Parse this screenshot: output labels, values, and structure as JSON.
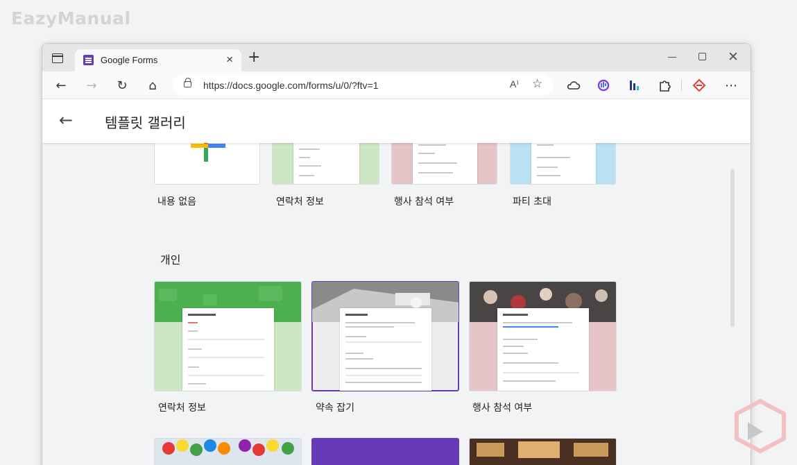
{
  "watermark": "EazyManual",
  "browser": {
    "tab_title": "Google Forms",
    "url": "https://docs.google.com/forms/u/0/?ftv=1",
    "icons": {
      "sidebar": "vertical-tabs-icon",
      "new_tab": "plus-icon",
      "back": "back-arrow-icon",
      "forward": "forward-arrow-icon",
      "refresh": "refresh-icon",
      "home": "home-icon",
      "lock": "lock-icon",
      "read_aloud": "read-aloud-icon",
      "favorite": "add-favorite-icon",
      "cloud": "cloud-icon",
      "extensions": "puzzle-icon",
      "more": "more-icon"
    },
    "tab_glyph": "☰",
    "close_glyph": "×",
    "new_tab_glyph": "+",
    "win_close_glyph": "✕",
    "read_aloud_glyph": "A⁾",
    "favorite_glyph": "☆",
    "more_glyph": "⋯",
    "back_glyph": "←",
    "forward_glyph": "→",
    "refresh_glyph": "↻",
    "home_glyph": "⌂"
  },
  "header": {
    "back_glyph": "←",
    "title": "템플릿 갤러리"
  },
  "top_row": [
    {
      "label": "내용 없음",
      "kind": "blank"
    },
    {
      "label": "연락처 정보",
      "kind": "contact"
    },
    {
      "label": "행사 참석 여부",
      "kind": "rsvp"
    },
    {
      "label": "파티 초대",
      "kind": "party"
    }
  ],
  "section": {
    "title": "개인"
  },
  "personal_row": [
    {
      "label": "연락처 정보",
      "kind": "contact"
    },
    {
      "label": "약속 잡기",
      "kind": "schedule"
    },
    {
      "label": "행사 참석 여부",
      "kind": "rsvp"
    }
  ],
  "colors": {
    "forms_purple": "#673ab7",
    "contact_green": "#4caf50",
    "contact_bg": "#cde6c4",
    "rsvp_bg": "#e6c4c8",
    "party_bg": "#b8e2f4"
  }
}
